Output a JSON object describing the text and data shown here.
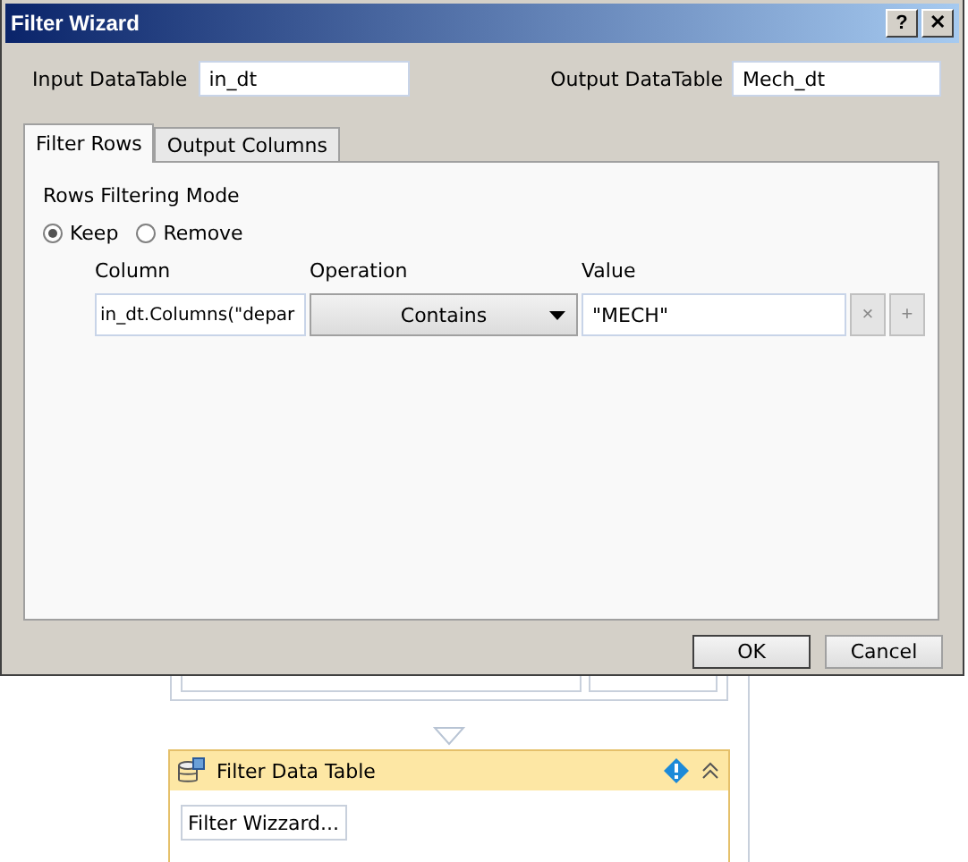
{
  "window": {
    "title": "Filter Wizard",
    "help_button": "?",
    "close_button": "✕"
  },
  "input_table": {
    "label": "Input DataTable",
    "value": "in_dt"
  },
  "output_table": {
    "label": "Output DataTable",
    "value": "Mech_dt"
  },
  "tabs": [
    {
      "label": "Filter Rows",
      "selected": true
    },
    {
      "label": "Output Columns",
      "selected": false
    }
  ],
  "filter_mode": {
    "label": "Rows Filtering Mode",
    "options": [
      {
        "label": "Keep",
        "selected": true
      },
      {
        "label": "Remove",
        "selected": false
      }
    ]
  },
  "columns": [
    "Column",
    "Operation",
    "Value"
  ],
  "rows": [
    {
      "column": "in_dt.Columns(\"depar",
      "operation": "Contains",
      "value": "\"MECH\"",
      "remove": "×",
      "add": "+"
    }
  ],
  "buttons": [
    "OK",
    "Cancel"
  ],
  "activity": {
    "title": "Filter Data Table",
    "button": "Filter Wizzard..."
  }
}
